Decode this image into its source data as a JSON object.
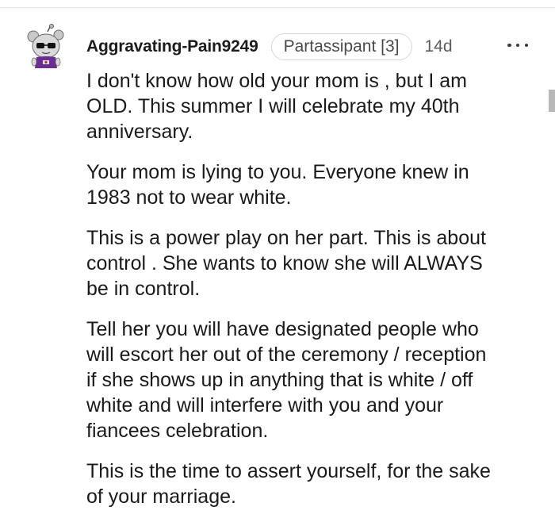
{
  "comment": {
    "author": "Aggravating-Pain9249",
    "flair": "Partassipant [3]",
    "age": "14d",
    "avatar_icon": "snoo-avatar-icon",
    "more_icon": "more-options-icon",
    "paragraphs": [
      "I don't know how old your mom is , but I am\nOLD. This summer I will celebrate my 40th\nanniversary.",
      "Your mom is lying to you. Everyone knew in\n1983 not to wear white.",
      "This is a power play on her part. This is about\ncontrol . She wants to know she will ALWAYS\nbe in control.",
      "Tell her you will have designated people who\nwill escort her out of the ceremony / reception\nif she shows up in anything that is white / off\nwhite and will interfere with you and your\nfiancees celebration.",
      "This is the time to assert yourself, for the sake\nof your marriage."
    ]
  },
  "colors": {
    "text": "#1a1a1b",
    "meta": "#5c5c5c",
    "flair_border": "#d7d7d7",
    "avatar_shirt": "#6a2d91"
  }
}
